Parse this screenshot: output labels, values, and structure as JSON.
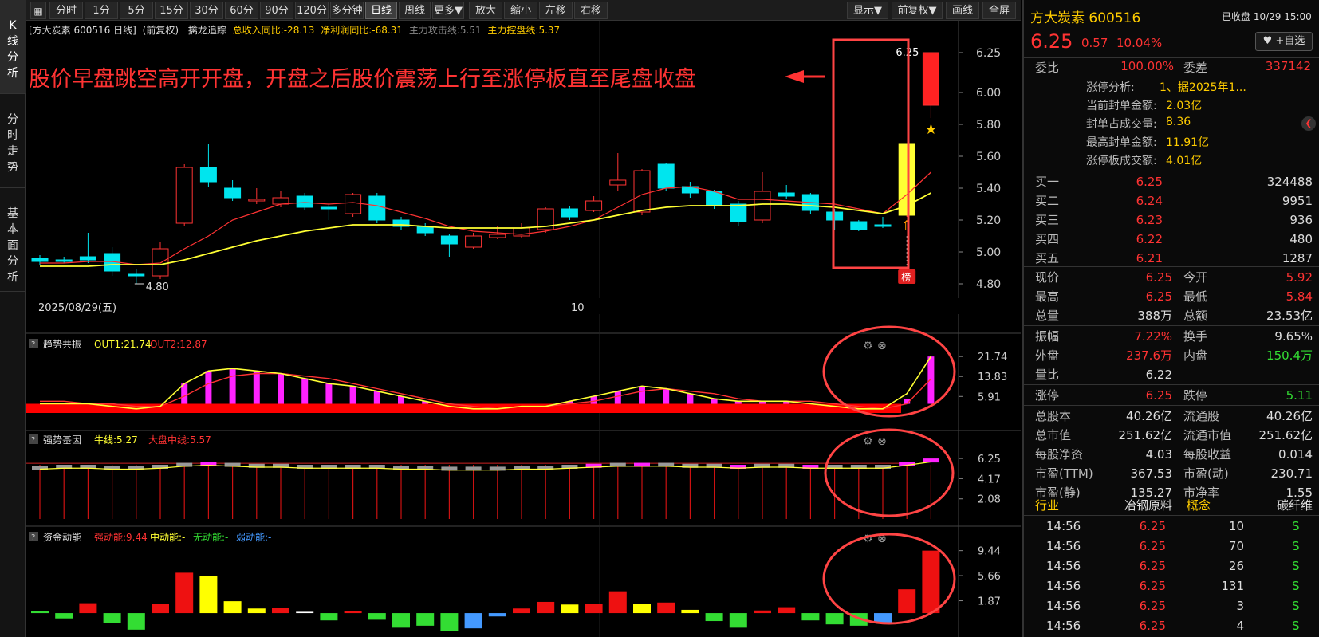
{
  "left_tabs": [
    "K线分析",
    "分时走势",
    "基本面分析"
  ],
  "toolbar": {
    "periods": [
      "分时",
      "1分",
      "5分",
      "15分",
      "30分",
      "60分",
      "90分",
      "120分",
      "多分钟",
      "日线",
      "周线",
      "更多▼"
    ],
    "active_period": "日线",
    "tools": [
      "放大",
      "缩小",
      "左移",
      "右移"
    ],
    "right_tools": [
      "显示▼",
      "前复权▼",
      "画线",
      "全屏"
    ]
  },
  "chart_header": {
    "stock_label": "[方大炭素 600516 日线]",
    "adjust": "(前复权)",
    "indicator": "擒龙追踪",
    "revenue": "总收入同比:-28.13",
    "profit": "净利润同比:-68.31",
    "attack": "主力攻击线:5.51",
    "control": "主力控盘线:5.37"
  },
  "annotation": "股价早盘跳空高开开盘，开盘之后股价震荡上行至涨停板直至尾盘收盘",
  "price_axis": [
    "6.25",
    "6.00",
    "5.80",
    "5.60",
    "5.40",
    "5.20",
    "5.00",
    "4.80"
  ],
  "main_labels": {
    "low_mark": "4.80",
    "high_mark": "6.25",
    "date": "2025/08/29(五)",
    "month_mark": "10",
    "badge": "榜"
  },
  "sub1": {
    "name": "趋势共振",
    "out1": "OUT1:21.74",
    "out2": "OUT2:12.87",
    "ticks": [
      "21.74",
      "13.83",
      "5.91"
    ]
  },
  "sub2": {
    "name": "强势基因",
    "bull": "牛线:5.27",
    "market": "大盘中线:5.57",
    "ticks": [
      "6.25",
      "4.17",
      "2.08"
    ]
  },
  "sub3": {
    "name": "资金动能",
    "strong": "强动能:9.44",
    "mid": "中动能:-",
    "none": "无动能:-",
    "weak": "弱动能:-",
    "ticks": [
      "9.44",
      "5.66",
      "1.87"
    ]
  },
  "chart_data": [
    {
      "type": "candlestick",
      "title": "方大炭素 600516 日线",
      "ylim": [
        4.7,
        6.3
      ],
      "candles": [
        {
          "o": 4.96,
          "c": 4.94,
          "h": 4.98,
          "l": 4.92
        },
        {
          "o": 4.95,
          "c": 4.94,
          "h": 4.97,
          "l": 4.93
        },
        {
          "o": 4.97,
          "c": 4.95,
          "h": 5.12,
          "l": 4.93
        },
        {
          "o": 4.99,
          "c": 4.88,
          "h": 5.03,
          "l": 4.85
        },
        {
          "o": 4.86,
          "c": 4.85,
          "h": 4.89,
          "l": 4.8
        },
        {
          "o": 4.85,
          "c": 5.02,
          "h": 5.06,
          "l": 4.83
        },
        {
          "o": 5.18,
          "c": 5.53,
          "h": 5.55,
          "l": 5.16
        },
        {
          "o": 5.53,
          "c": 5.44,
          "h": 5.68,
          "l": 5.41
        },
        {
          "o": 5.4,
          "c": 5.34,
          "h": 5.45,
          "l": 5.32
        },
        {
          "o": 5.32,
          "c": 5.33,
          "h": 5.4,
          "l": 5.3
        },
        {
          "o": 5.3,
          "c": 5.34,
          "h": 5.38,
          "l": 5.28
        },
        {
          "o": 5.35,
          "c": 5.28,
          "h": 5.37,
          "l": 5.26
        },
        {
          "o": 5.28,
          "c": 5.27,
          "h": 5.31,
          "l": 5.2
        },
        {
          "o": 5.24,
          "c": 5.36,
          "h": 5.37,
          "l": 5.22
        },
        {
          "o": 5.35,
          "c": 5.2,
          "h": 5.37,
          "l": 5.18
        },
        {
          "o": 5.2,
          "c": 5.16,
          "h": 5.22,
          "l": 5.14
        },
        {
          "o": 5.16,
          "c": 5.12,
          "h": 5.18,
          "l": 5.1
        },
        {
          "o": 5.1,
          "c": 5.05,
          "h": 5.11,
          "l": 4.97
        },
        {
          "o": 5.03,
          "c": 5.1,
          "h": 5.12,
          "l": 5.02
        },
        {
          "o": 5.09,
          "c": 5.11,
          "h": 5.16,
          "l": 5.08
        },
        {
          "o": 5.1,
          "c": 5.15,
          "h": 5.18,
          "l": 5.09
        },
        {
          "o": 5.14,
          "c": 5.27,
          "h": 5.28,
          "l": 5.12
        },
        {
          "o": 5.27,
          "c": 5.22,
          "h": 5.29,
          "l": 5.2
        },
        {
          "o": 5.26,
          "c": 5.32,
          "h": 5.35,
          "l": 5.25
        },
        {
          "o": 5.42,
          "c": 5.45,
          "h": 5.62,
          "l": 5.38
        },
        {
          "o": 5.25,
          "c": 5.51,
          "h": 5.52,
          "l": 5.23
        },
        {
          "o": 5.55,
          "c": 5.4,
          "h": 5.56,
          "l": 5.38
        },
        {
          "o": 5.41,
          "c": 5.37,
          "h": 5.44,
          "l": 5.34
        },
        {
          "o": 5.38,
          "c": 5.29,
          "h": 5.39,
          "l": 5.27
        },
        {
          "o": 5.3,
          "c": 5.19,
          "h": 5.32,
          "l": 5.16
        },
        {
          "o": 5.2,
          "c": 5.38,
          "h": 5.5,
          "l": 5.18
        },
        {
          "o": 5.37,
          "c": 5.35,
          "h": 5.42,
          "l": 5.33
        },
        {
          "o": 5.36,
          "c": 5.26,
          "h": 5.37,
          "l": 5.24
        },
        {
          "o": 5.25,
          "c": 5.2,
          "h": 5.27,
          "l": 5.14
        },
        {
          "o": 5.19,
          "c": 5.14,
          "h": 5.2,
          "l": 5.13
        },
        {
          "o": 5.17,
          "c": 5.16,
          "h": 5.22,
          "l": 5.15
        },
        {
          "o": 5.23,
          "c": 5.68,
          "h": 5.68,
          "l": 5.22
        },
        {
          "o": 5.92,
          "c": 6.25,
          "h": 6.25,
          "l": 5.84
        }
      ],
      "ma_red": [
        4.93,
        4.93,
        4.94,
        4.94,
        4.92,
        4.93,
        5.02,
        5.1,
        5.2,
        5.25,
        5.3,
        5.31,
        5.3,
        5.31,
        5.29,
        5.25,
        5.21,
        5.16,
        5.13,
        5.12,
        5.11,
        5.13,
        5.16,
        5.2,
        5.28,
        5.36,
        5.4,
        5.41,
        5.38,
        5.33,
        5.33,
        5.32,
        5.31,
        5.3,
        5.27,
        5.24,
        5.36,
        5.5
      ],
      "ma_yellow": [
        4.91,
        4.91,
        4.91,
        4.92,
        4.92,
        4.92,
        4.95,
        4.99,
        5.03,
        5.07,
        5.1,
        5.13,
        5.15,
        5.17,
        5.17,
        5.17,
        5.16,
        5.15,
        5.15,
        5.15,
        5.15,
        5.16,
        5.18,
        5.2,
        5.23,
        5.26,
        5.28,
        5.29,
        5.29,
        5.29,
        5.3,
        5.3,
        5.29,
        5.28,
        5.26,
        5.24,
        5.29,
        5.37
      ]
    },
    {
      "type": "bar",
      "title": "趋势共振",
      "ylim": [
        0,
        24
      ],
      "values": [
        3,
        3,
        3,
        2,
        1,
        2,
        11,
        16,
        17,
        16,
        15,
        13,
        11,
        10,
        8,
        6,
        4,
        2,
        1,
        1,
        2,
        2,
        4,
        6,
        8,
        10,
        9,
        7,
        5,
        4,
        4,
        4,
        3,
        2,
        1,
        1,
        5,
        21.74
      ],
      "out1": [
        3,
        3,
        3,
        2,
        1,
        2,
        11,
        16,
        17,
        16,
        15,
        13,
        11,
        10,
        8,
        6,
        4,
        2,
        1,
        1,
        2,
        2,
        4,
        6,
        8,
        10,
        9,
        7,
        5,
        4,
        4,
        4,
        3,
        2,
        1,
        1,
        7,
        21.74
      ],
      "out2": [
        4,
        4,
        3,
        3,
        2,
        2,
        6,
        11,
        14,
        15,
        15,
        14,
        13,
        11,
        9,
        7,
        5,
        3,
        2,
        1,
        2,
        2,
        3,
        4,
        6,
        8,
        9,
        8,
        7,
        5,
        4,
        4,
        4,
        3,
        2,
        1,
        3,
        12.87
      ],
      "base": 3
    },
    {
      "type": "bar",
      "title": "强势基因",
      "ylim": [
        0,
        7
      ],
      "bar_values": [
        5.5,
        5.6,
        5.6,
        5.5,
        5.5,
        5.6,
        5.8,
        5.9,
        5.8,
        5.7,
        5.7,
        5.6,
        5.6,
        5.6,
        5.6,
        5.5,
        5.5,
        5.4,
        5.4,
        5.4,
        5.5,
        5.5,
        5.6,
        5.7,
        5.8,
        5.8,
        5.8,
        5.7,
        5.7,
        5.6,
        5.7,
        5.7,
        5.6,
        5.6,
        5.6,
        5.6,
        5.9,
        6.25
      ],
      "highlight": [
        false,
        false,
        false,
        false,
        false,
        false,
        false,
        true,
        false,
        false,
        false,
        false,
        false,
        false,
        false,
        false,
        false,
        false,
        false,
        false,
        false,
        false,
        false,
        true,
        false,
        true,
        false,
        false,
        false,
        true,
        false,
        false,
        true,
        false,
        false,
        false,
        true,
        true
      ]
    },
    {
      "type": "bar",
      "title": "资金动能",
      "ylim": [
        -3,
        10
      ],
      "values": [
        0.3,
        -0.8,
        1.5,
        -1.5,
        -2.5,
        1.4,
        6.1,
        5.6,
        1.8,
        0.7,
        0.8,
        0.2,
        -1.1,
        0.3,
        -1.0,
        -2.2,
        -1.9,
        -2.7,
        -2.3,
        -0.5,
        0.7,
        1.7,
        1.3,
        1.4,
        3.3,
        1.4,
        1.6,
        0.5,
        -1.2,
        -2.2,
        0.4,
        0.9,
        -1.1,
        -1.7,
        -1.9,
        -1.4,
        3.6,
        9.44
      ],
      "colors": [
        "#33dd33",
        "#33dd33",
        "#ee1111",
        "#33dd33",
        "#33dd33",
        "#ee1111",
        "#ee1111",
        "#ffff00",
        "#ffff00",
        "#ffff00",
        "#ee1111",
        "#ffffff",
        "#33dd33",
        "#ee1111",
        "#33dd33",
        "#33dd33",
        "#33dd33",
        "#33dd33",
        "#4499ff",
        "#4499ff",
        "#ee1111",
        "#ee1111",
        "#ffff00",
        "#ee1111",
        "#ee1111",
        "#ffff00",
        "#ee1111",
        "#ffff00",
        "#33dd33",
        "#33dd33",
        "#ee1111",
        "#ee1111",
        "#33dd33",
        "#33dd33",
        "#33dd33",
        "#4499ff",
        "#ee1111",
        "#ee1111"
      ]
    }
  ],
  "panel": {
    "name": "方大炭素 600516",
    "status": "已收盘 10/29 15:00",
    "price": "6.25",
    "change": "0.57",
    "pct": "10.04%",
    "watch_btn": "+自选",
    "weibi_label": "委比",
    "weibi": "100.00%",
    "weicha_label": "委差",
    "weicha": "337142",
    "limit": [
      {
        "k": "涨停分析:",
        "v": "1、据2025年1..."
      },
      {
        "k": "当前封单金额:",
        "v": "2.03亿"
      },
      {
        "k": "封单占成交量:",
        "v": "8.36"
      },
      {
        "k": "最高封单金额:",
        "v": "11.91亿"
      },
      {
        "k": "涨停板成交额:",
        "v": "4.01亿"
      }
    ],
    "bids": [
      {
        "k": "买一",
        "p": "6.25",
        "v": "324488"
      },
      {
        "k": "买二",
        "p": "6.24",
        "v": "9951"
      },
      {
        "k": "买三",
        "p": "6.23",
        "v": "936"
      },
      {
        "k": "买四",
        "p": "6.22",
        "v": "480"
      },
      {
        "k": "买五",
        "p": "6.21",
        "v": "1287"
      }
    ],
    "stats1": [
      {
        "k1": "现价",
        "v1": "6.25",
        "c1": "red",
        "k2": "今开",
        "v2": "5.92",
        "c2": "red"
      },
      {
        "k1": "最高",
        "v1": "6.25",
        "c1": "red",
        "k2": "最低",
        "v2": "5.84",
        "c2": "red"
      },
      {
        "k1": "总量",
        "v1": "388万",
        "c1": "white",
        "k2": "总额",
        "v2": "23.53亿",
        "c2": "white"
      }
    ],
    "stats2": [
      {
        "k1": "振幅",
        "v1": "7.22%",
        "c1": "red",
        "k2": "换手",
        "v2": "9.65%",
        "c2": "white"
      },
      {
        "k1": "外盘",
        "v1": "237.6万",
        "c1": "red",
        "k2": "内盘",
        "v2": "150.4万",
        "c2": "green"
      },
      {
        "k1": "量比",
        "v1": "6.22",
        "c1": "white",
        "k2": "",
        "v2": "",
        "c2": "white"
      }
    ],
    "stats3": [
      {
        "k1": "涨停",
        "v1": "6.25",
        "c1": "red",
        "k2": "跌停",
        "v2": "5.11",
        "c2": "green"
      }
    ],
    "stats4": [
      {
        "k1": "总股本",
        "v1": "40.26亿",
        "k2": "流通股",
        "v2": "40.26亿"
      },
      {
        "k1": "总市值",
        "v1": "251.62亿",
        "k2": "流通市值",
        "v2": "251.62亿"
      },
      {
        "k1": "每股净资",
        "v1": "4.03",
        "k2": "每股收益",
        "v2": "0.014"
      },
      {
        "k1": "市盈(TTM)",
        "v1": "367.53",
        "k2": "市盈(动)",
        "v2": "230.71"
      },
      {
        "k1": "市盈(静)",
        "v1": "135.27",
        "k2": "市净率",
        "v2": "1.55"
      }
    ],
    "industry": {
      "k1": "行业",
      "v1": "冶钢原料",
      "k2": "概念",
      "v2": "碳纤维"
    },
    "ticks": [
      {
        "t": "14:56",
        "p": "6.25",
        "v": "10",
        "s": "S"
      },
      {
        "t": "14:56",
        "p": "6.25",
        "v": "70",
        "s": "S"
      },
      {
        "t": "14:56",
        "p": "6.25",
        "v": "26",
        "s": "S"
      },
      {
        "t": "14:56",
        "p": "6.25",
        "v": "131",
        "s": "S"
      },
      {
        "t": "14:56",
        "p": "6.25",
        "v": "3",
        "s": "S"
      },
      {
        "t": "14:56",
        "p": "6.25",
        "v": "4",
        "s": "S"
      }
    ]
  }
}
